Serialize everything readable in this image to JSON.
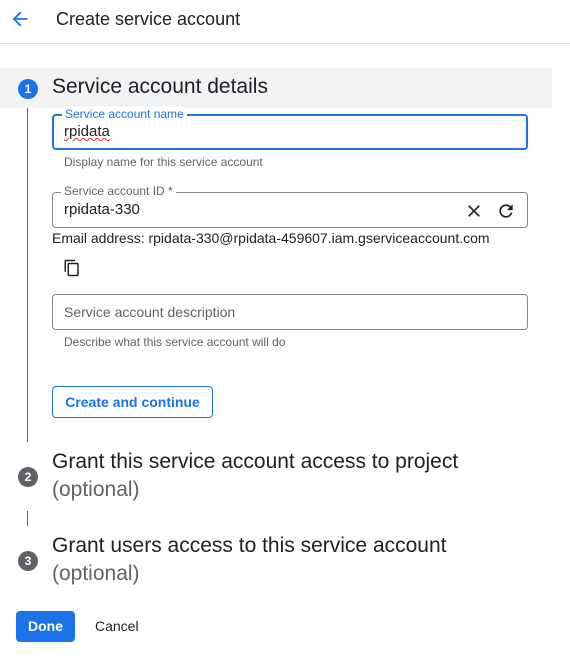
{
  "header": {
    "title": "Create service account"
  },
  "steps": [
    {
      "number": "1",
      "title": "Service account details"
    },
    {
      "number": "2",
      "title": "Grant this service account access to project",
      "optional": "(optional)"
    },
    {
      "number": "3",
      "title": "Grant users access to this service account",
      "optional": "(optional)"
    }
  ],
  "form": {
    "name_field": {
      "label": "Service account name",
      "value": "rpidata",
      "hint": "Display name for this service account"
    },
    "id_field": {
      "label": "Service account ID *",
      "value": "rpidata-330"
    },
    "email": "Email address: rpidata-330@rpidata-459607.iam.gserviceaccount.com",
    "description_field": {
      "placeholder": "Service account description",
      "hint": "Describe what this service account will do"
    }
  },
  "buttons": {
    "create_continue": "Create and continue",
    "done": "Done",
    "cancel": "Cancel"
  },
  "icons": {
    "back": "arrow-back-icon",
    "clear": "close-icon",
    "refresh": "refresh-icon",
    "copy": "copy-icon"
  },
  "colors": {
    "accent": "#1a73e8",
    "inactive_step": "#5f6368",
    "step_band": "#f1f3f4"
  }
}
